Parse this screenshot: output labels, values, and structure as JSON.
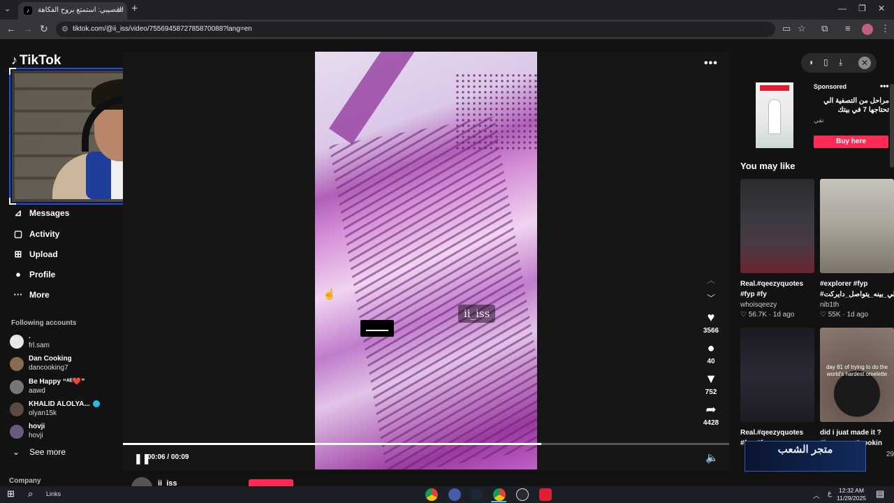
{
  "browser": {
    "tab_title": "القصيبي: استمتع بروح الفكاهة",
    "url": "tiktok.com/@ii_iss/video/7556945872785870088?lang=en"
  },
  "sidebar": {
    "logo": "TikTok",
    "nav": [
      {
        "label": "Messages",
        "icon": "paper-plane-icon"
      },
      {
        "label": "Activity",
        "icon": "inbox-icon"
      },
      {
        "label": "Upload",
        "icon": "plus-square-icon"
      },
      {
        "label": "Profile",
        "icon": "avatar-icon"
      },
      {
        "label": "More",
        "icon": "ellipsis-icon"
      }
    ],
    "following_title": "Following accounts",
    "accounts": [
      {
        "name": ".",
        "handle": "frl.sam",
        "verified": false,
        "color": "#e8e8e8"
      },
      {
        "name": "Dan Cooking",
        "handle": "dancooking7",
        "verified": false,
        "color": "#8a6a50"
      },
      {
        "name": "Be Happy “ᴬᴱ❤️”",
        "handle": "aawd",
        "verified": false,
        "color": "#777777"
      },
      {
        "name": "KHALID ALOLYA...",
        "handle": "olyan15k",
        "verified": true,
        "color": "#5a4a40"
      },
      {
        "name": "hovji",
        "handle": "hovji",
        "verified": false,
        "color": "#6a5a80"
      }
    ],
    "see_more": "See more",
    "company": "Company"
  },
  "video": {
    "watermark": "ii_iss",
    "time": "00:06 / 00:09",
    "progress_fraction": 0.69,
    "author": "ii_iss",
    "actions": [
      {
        "name": "like",
        "icon": "heart-icon",
        "glyph": "♥",
        "count": "3566"
      },
      {
        "name": "comment",
        "icon": "comment-icon",
        "glyph": "💬",
        "count": "40"
      },
      {
        "name": "bookmark",
        "icon": "bookmark-icon",
        "glyph": "🔖",
        "count": "752"
      },
      {
        "name": "share",
        "icon": "share-icon",
        "glyph": "➦",
        "count": "4428"
      }
    ]
  },
  "ad": {
    "sponsored": "Sponsored",
    "title": "مراحل من التصفية الي تحتاجها 7 في بيتك",
    "brand": "نقي",
    "button": "Buy here"
  },
  "recommendations": {
    "heading": "You may like",
    "items": [
      {
        "title": "Real.#qeezyquotes",
        "title2": "#fyp #fy",
        "author": "whoisqeezy",
        "likes": "56.7K",
        "age": "1d ago"
      },
      {
        "title": "#explorer #fyp",
        "title2": "#اللي_بينه_يتواصل_دايركت",
        "author": "nib1th",
        "likes": "55K",
        "age": "1d ago"
      },
      {
        "title": "Real.#qeezyquotes",
        "title2": "#fyp #fy",
        "author": "",
        "likes": "",
        "age": ""
      },
      {
        "title": "did i juat made it ?",
        "title2": "#japanese #cookin",
        "author": "",
        "likes": "",
        "age": "29"
      }
    ],
    "thumb_text_4": "day 81 of trying to do the world's hardest omelette"
  },
  "overlay_store": "متجر الشعب",
  "taskbar": {
    "links": "Links",
    "time": "12:32 AM",
    "date": "11/29/2025",
    "lang": "ع"
  }
}
